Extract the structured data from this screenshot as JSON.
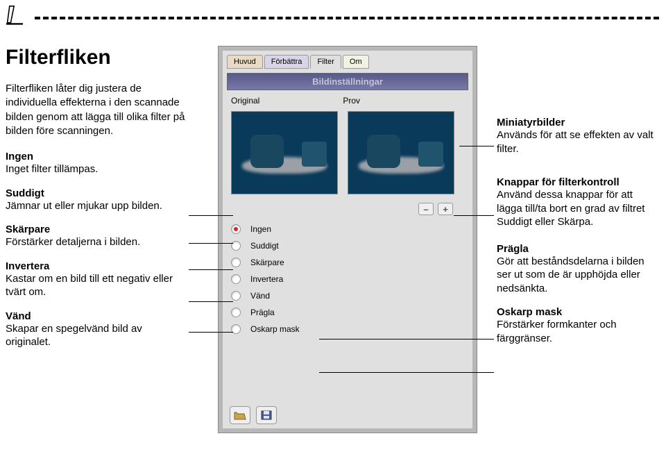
{
  "top": {
    "title": "Filterfliken",
    "intro": "Filterfliken låter dig justera de individuella effekterna i den scannade bilden genom att lägga till olika filter på bilden före scanningen."
  },
  "left": [
    {
      "label": "Ingen",
      "text": "Inget filter tillämpas."
    },
    {
      "label": "Suddigt",
      "text": "Jämnar ut eller mjukar upp bilden."
    },
    {
      "label": "Skärpare",
      "text": "Förstärker detaljerna i bilden."
    },
    {
      "label": "Invertera",
      "text": "Kastar om en bild till ett negativ eller tvärt om."
    },
    {
      "label": "Vänd",
      "text": "Skapar en spegelvänd bild av originalet."
    }
  ],
  "right": [
    {
      "label": "Miniatyrbilder",
      "text": "Används för att se effekten av valt filter."
    },
    {
      "label": "Knappar för filterkontroll",
      "text": "Använd dessa knappar för att lägga till/ta bort en grad av filtret Suddigt eller Skärpa."
    },
    {
      "label": "Prägla",
      "text": "Gör att beståndsdelarna i bilden ser ut som de är upphöjda eller nedsänkta."
    },
    {
      "label": "Oskarp mask",
      "text": "Förstärker formkanter och färggränser."
    }
  ],
  "panel": {
    "tabs": [
      "Huvud",
      "Förbättra",
      "Filter",
      "Om"
    ],
    "bar": "Bildinställningar",
    "thumbLabels": [
      "Original",
      "Prov"
    ],
    "minus": "–",
    "plus": "+",
    "radios": [
      "Ingen",
      "Suddigt",
      "Skärpare",
      "Invertera",
      "Vänd",
      "Prägla",
      "Oskarp mask"
    ]
  }
}
